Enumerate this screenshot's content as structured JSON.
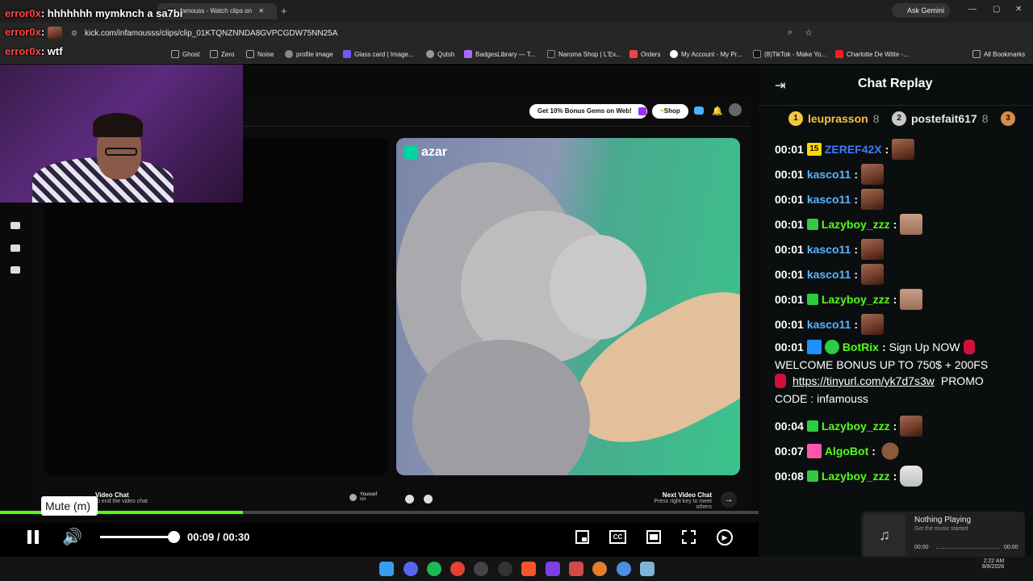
{
  "browser": {
    "tab_title": "famouss - Watch clips on",
    "url": "kick.com/infamousss/clips/clip_01KTQNZNNDA8GVPCGDW75NN25A",
    "ask_gemini": "Ask Gemini",
    "bookmarks": [
      "Ghost",
      "Zero",
      "Noise",
      "profile image",
      "Glass card | Image...",
      "Qutsh",
      "BadgesLibrary — T...",
      "Naroma Shop | L'Ex...",
      "Orders",
      "My Account - My Pr...",
      "(8)TikTok - Make Yo...",
      "Charlotte De Witte -...",
      "All Bookmarks"
    ]
  },
  "overlay_chat": [
    {
      "user": "error0x",
      "text": ": hhhhhhh mymknch a sa7bi"
    },
    {
      "user": "error0x",
      "text": ":"
    },
    {
      "user": "error0x",
      "text": ": wtf"
    }
  ],
  "video": {
    "gems_button": "Get 10% Bonus Gems on Web!",
    "shop_button": "Shop",
    "azar_logo": "azar",
    "left_caption": "Video Chat",
    "left_sub": "to end the video chat",
    "user_name": "Youssef",
    "user_country": "MA",
    "next_title": "Next Video Chat",
    "next_sub": "Press right key to meet others",
    "progress": 0.32,
    "volume": 0.92
  },
  "controls": {
    "time_current": "00:09",
    "time_sep": "/",
    "time_total": "00:30",
    "tooltip": "Mute (m)"
  },
  "chat": {
    "title": "Chat Replay",
    "leaderboard": [
      {
        "rank": "1",
        "name": "leuprasson",
        "count": "8",
        "color": "#f5c542"
      },
      {
        "rank": "2",
        "name": "postefait617",
        "count": "8",
        "color": "#c8c8c8"
      },
      {
        "rank": "3",
        "name": "",
        "count": "",
        "color": "#d98c4a"
      }
    ],
    "messages": [
      {
        "ts": "00:01",
        "user": "ZEREF42X",
        "color": "#3d7bff",
        "badge": "15"
      },
      {
        "ts": "00:01",
        "user": "kasco11",
        "color": "#5ab4ff"
      },
      {
        "ts": "00:01",
        "user": "kasco11",
        "color": "#5ab4ff"
      },
      {
        "ts": "00:01",
        "user": "Lazyboy_zzz",
        "color": "#53fc18"
      },
      {
        "ts": "00:01",
        "user": "kasco11",
        "color": "#5ab4ff"
      },
      {
        "ts": "00:01",
        "user": "kasco11",
        "color": "#5ab4ff"
      },
      {
        "ts": "00:01",
        "user": "Lazyboy_zzz",
        "color": "#53fc18"
      },
      {
        "ts": "00:01",
        "user": "kasco11",
        "color": "#5ab4ff"
      },
      {
        "ts": "00:01",
        "user": "BotRix",
        "color": "#53fc18"
      },
      {
        "ts": "00:04",
        "user": "Lazyboy_zzz",
        "color": "#53fc18"
      },
      {
        "ts": "00:07",
        "user": "AlgoBot",
        "color": "#53fc18"
      },
      {
        "ts": "00:08",
        "user": "Lazyboy_zzz",
        "color": "#53fc18"
      }
    ],
    "botrix_text1": "Sign Up NOW",
    "botrix_text2": "WELCOME BONUS UP TO 750$ + 200FS",
    "botrix_link": "https://tinyurl.com/yk7d7s3w",
    "botrix_text3": "PROMO",
    "botrix_text4": "CODE : infamouss"
  },
  "music": {
    "title": "Nothing Playing",
    "subtitle": "Get the music started",
    "time_start": "00:00",
    "time_end": "00:00"
  },
  "taskbar": {
    "time": "2:22 AM",
    "date": "8/8/2026"
  }
}
